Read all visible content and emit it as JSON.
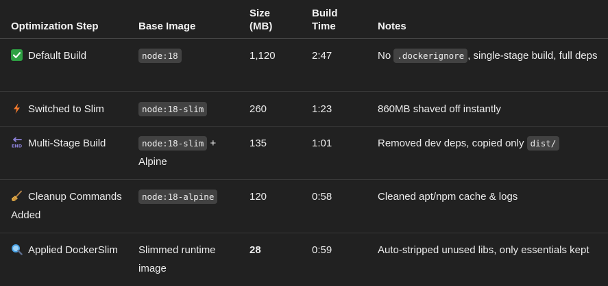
{
  "table": {
    "headers": {
      "step": "Optimization Step",
      "base_image": "Base Image",
      "size": "Size\n(MB)",
      "build_time": "Build\nTime",
      "notes": "Notes"
    },
    "rows": [
      {
        "icon": "check-mark-icon",
        "step": "Default Build",
        "base_image_code": "node:18",
        "size": "1,120",
        "build_time": "2:47",
        "notes_before": "No ",
        "notes_code": ".dockerignore",
        "notes_after": ", single-stage build, full deps"
      },
      {
        "icon": "lightning-icon",
        "step": "Switched to Slim",
        "base_image_code": "node:18-slim",
        "size": "260",
        "build_time": "1:23",
        "notes": "860MB shaved off instantly"
      },
      {
        "icon": "end-arrow-icon",
        "step": "Multi-Stage Build",
        "base_image_code": "node:18-slim",
        "base_image_suffix": " + Alpine",
        "size": "135",
        "build_time": "1:01",
        "notes_before": "Removed dev deps, copied only ",
        "notes_code": "dist/"
      },
      {
        "icon": "broom-icon",
        "step": "Cleanup Commands Added",
        "base_image_code": "node:18-alpine",
        "size": "120",
        "build_time": "0:58",
        "notes": "Cleaned apt/npm cache & logs"
      },
      {
        "icon": "magnifying-glass-icon",
        "step": "Applied DockerSlim",
        "base_image": "Slimmed runtime image",
        "size": "28",
        "build_time": "0:59",
        "notes": "Auto-stripped unused libs, only essentials kept"
      }
    ]
  },
  "colors": {
    "background": "#212121",
    "text": "#ececec",
    "code_background": "#424242",
    "check_green": "#2ea043",
    "lightning_orange": "#f2792c",
    "end_purple": "#8a7fd6",
    "broom_brown": "#c08a4a",
    "magnifier_blue": "#4aa3e6"
  }
}
